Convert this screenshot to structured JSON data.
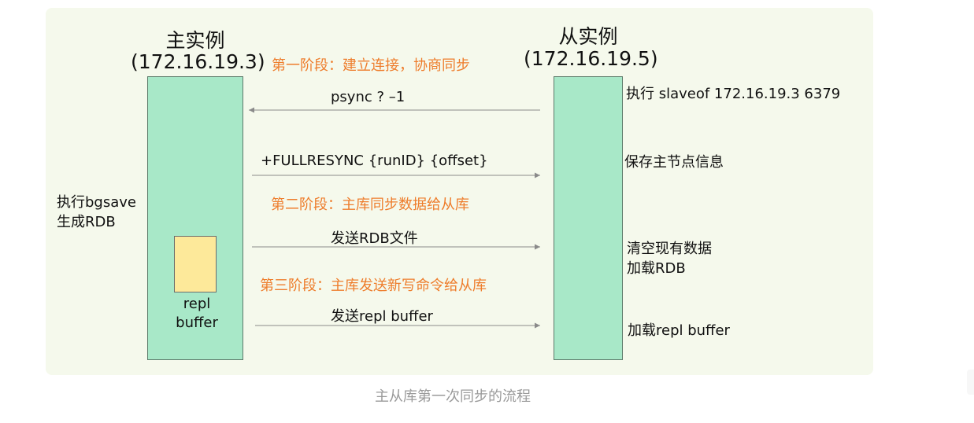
{
  "master": {
    "title": "主实例",
    "ip": "(172.16.19.3)",
    "note_line1": "执行bgsave",
    "note_line2": "生成RDB",
    "buffer_line1": "repl",
    "buffer_line2": "buffer"
  },
  "slave": {
    "title": "从实例",
    "ip": "(172.16.19.5)",
    "note_slaveof": "执行 slaveof  172.16.19.3  6379",
    "note_save": "保存主节点信息",
    "note_clear_line1": "清空现有数据",
    "note_clear_line2": "加载RDB",
    "note_load_buffer": "加载repl buffer"
  },
  "phases": {
    "phase1": "第一阶段：建立连接，协商同步",
    "phase2": "第二阶段：主库同步数据给从库",
    "phase3": "第三阶段：主库发送新写命令给从库"
  },
  "messages": {
    "psync": "psync ? –1",
    "fullresync": "+FULLRESYNC {runID} {offset}",
    "send_rdb": "发送RDB文件",
    "send_buffer": "发送repl buffer"
  },
  "caption": "主从库第一次同步的流程",
  "colors": {
    "panel_bg": "#f5f9ec",
    "instance_fill": "#a8e8c8",
    "buffer_fill": "#fde99a",
    "phase_text": "#ee7d2c",
    "arrow": "#8a8a8a",
    "caption": "#9a9a9a"
  }
}
